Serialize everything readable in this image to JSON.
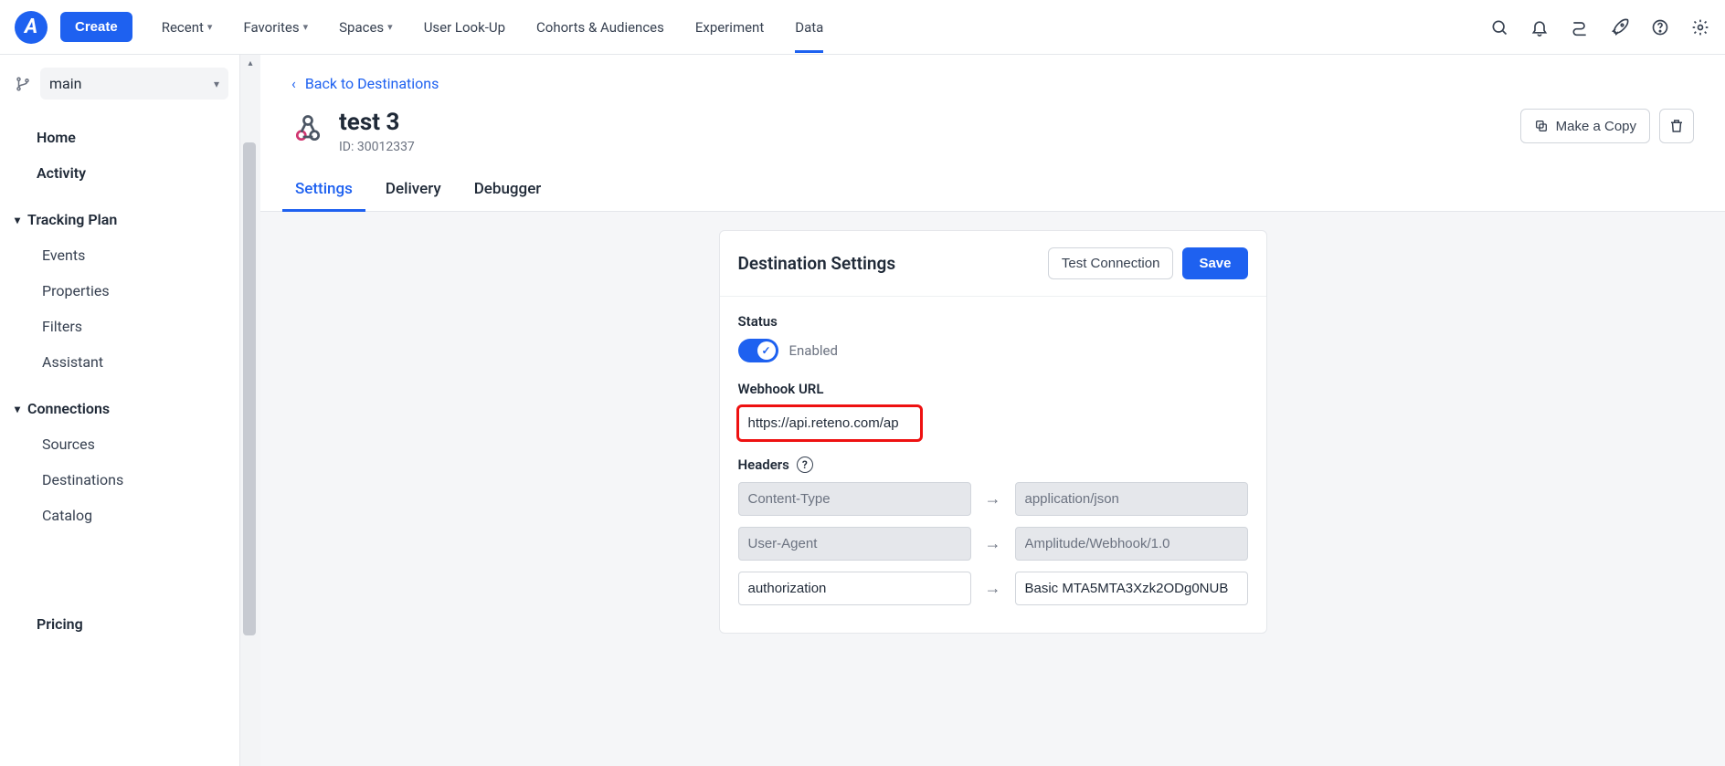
{
  "topbar": {
    "create": "Create",
    "nav": [
      "Recent",
      "Favorites",
      "Spaces",
      "User Look-Up",
      "Cohorts & Audiences",
      "Experiment",
      "Data"
    ],
    "nav_has_caret": [
      true,
      true,
      true,
      false,
      false,
      false,
      false
    ],
    "active_index": 6
  },
  "sidebar": {
    "branch": "main",
    "items": {
      "home": "Home",
      "activity": "Activity",
      "tracking_plan": "Tracking Plan",
      "events": "Events",
      "properties": "Properties",
      "filters": "Filters",
      "assistant": "Assistant",
      "connections": "Connections",
      "sources": "Sources",
      "destinations": "Destinations",
      "catalog": "Catalog",
      "pricing": "Pricing"
    }
  },
  "page": {
    "back": "Back to Destinations",
    "title": "test 3",
    "id_label": "ID: 30012337",
    "make_copy": "Make a Copy",
    "tabs": [
      "Settings",
      "Delivery",
      "Debugger"
    ],
    "active_tab": 0
  },
  "card": {
    "title": "Destination Settings",
    "test": "Test Connection",
    "save": "Save",
    "status_label": "Status",
    "status_value": "Enabled",
    "webhook_label": "Webhook URL",
    "webhook_value": "https://api.reteno.com/ap",
    "headers_label": "Headers",
    "headers": [
      {
        "key": "Content-Type",
        "value": "application/json",
        "locked": true
      },
      {
        "key": "User-Agent",
        "value": "Amplitude/Webhook/1.0",
        "locked": true
      },
      {
        "key": "authorization",
        "value": "Basic MTA5MTA3Xzk2ODg0NUB",
        "locked": false
      }
    ]
  }
}
